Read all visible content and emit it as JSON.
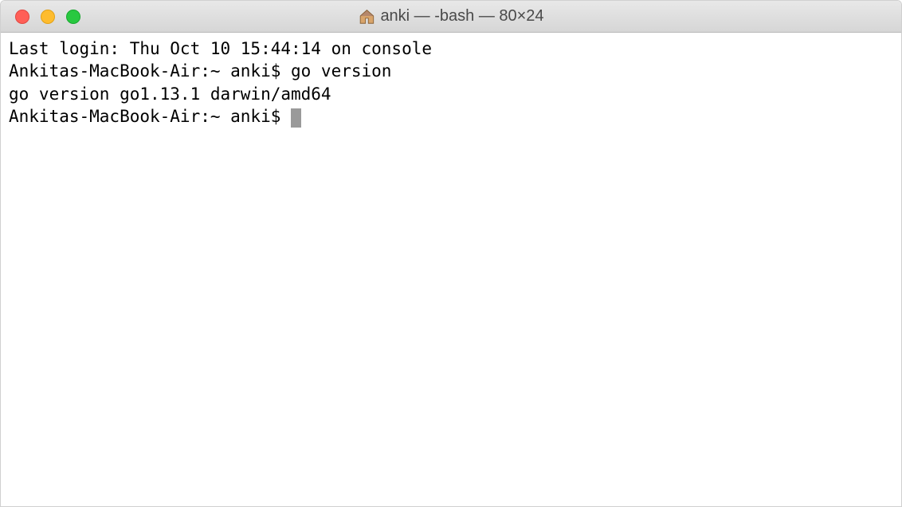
{
  "window": {
    "title": "anki — -bash — 80×24",
    "icon": "home-icon"
  },
  "terminal": {
    "lines": [
      "Last login: Thu Oct 10 15:44:14 on console",
      "Ankitas-MacBook-Air:~ anki$ go version",
      "go version go1.13.1 darwin/amd64"
    ],
    "prompt": "Ankitas-MacBook-Air:~ anki$ "
  }
}
